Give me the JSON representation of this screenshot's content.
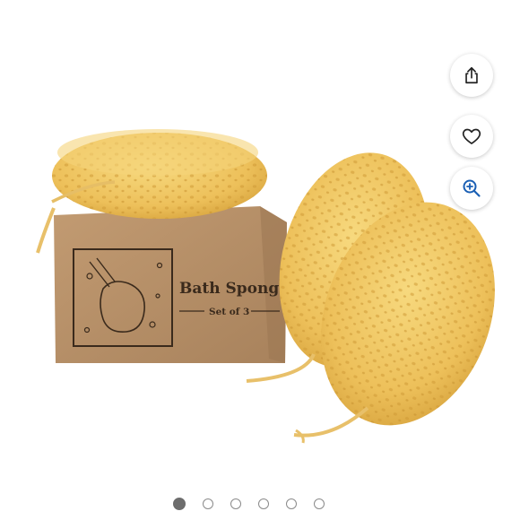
{
  "product_image": {
    "alt_semantic": "bath sponges product photo",
    "box_title": "Bath Sponge",
    "box_subtitle": "Set of 3"
  },
  "actions": {
    "share_icon": "share-icon",
    "favorite_icon": "heart-icon",
    "zoom_icon": "zoom-in-icon",
    "zoom_color": "#1a5fb4"
  },
  "carousel": {
    "count": 6,
    "active_index": 0
  },
  "colors": {
    "sponge": "#f0c45c",
    "box": "#b9926a"
  }
}
